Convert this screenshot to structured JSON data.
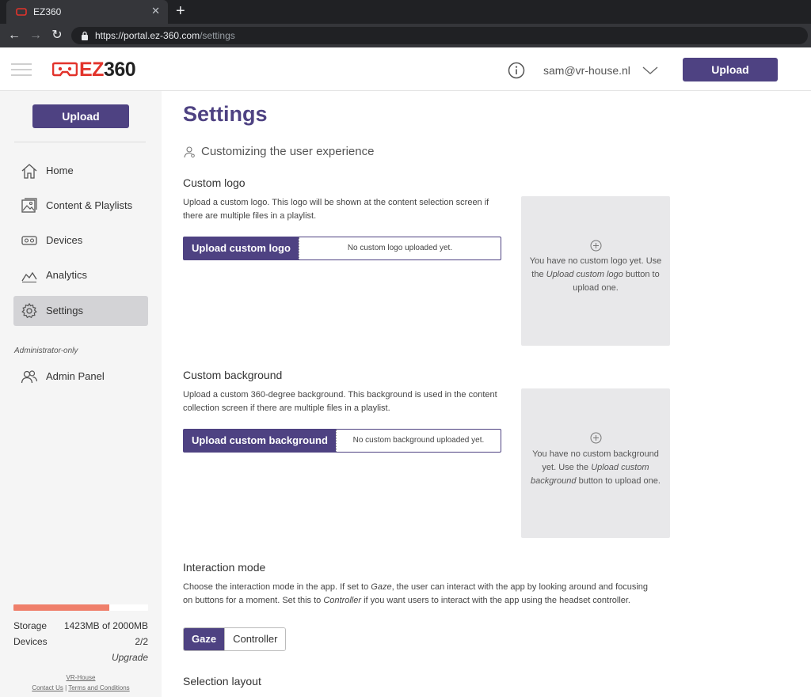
{
  "browser": {
    "tab_title": "EZ360",
    "url_host": "https://portal.ez-360.com",
    "url_path": "/settings"
  },
  "header": {
    "logo_prefix": "EZ",
    "logo_suffix": "360",
    "user_email": "sam@vr-house.nl",
    "upload_label": "Upload"
  },
  "sidebar": {
    "upload_label": "Upload",
    "items": [
      {
        "label": "Home",
        "icon": "home-icon"
      },
      {
        "label": "Content & Playlists",
        "icon": "image-icon"
      },
      {
        "label": "Devices",
        "icon": "vr-headset-icon"
      },
      {
        "label": "Analytics",
        "icon": "line-chart-icon"
      },
      {
        "label": "Settings",
        "icon": "gear-icon",
        "active": true
      }
    ],
    "admin_label": "Administrator-only",
    "admin_item": {
      "label": "Admin Panel",
      "icon": "users-icon"
    },
    "storage_label": "Storage",
    "storage_value": "1423MB of 2000MB",
    "storage_fraction": 0.71,
    "devices_label": "Devices",
    "devices_value": "2/2",
    "upgrade_label": "Upgrade",
    "footer_company": "VR-House",
    "footer_contact": "Contact Us",
    "footer_sep": "|",
    "footer_terms": "Terms and Conditions"
  },
  "main": {
    "title": "Settings",
    "subtitle": "Customizing the user experience",
    "custom_logo": {
      "title": "Custom logo",
      "description": "Upload a custom logo. This logo will be shown at the content selection screen if there are multiple files in a playlist.",
      "button_label": "Upload custom logo",
      "status": "No custom logo uploaded yet.",
      "preview_text_1": "You have no custom logo yet. Use the ",
      "preview_text_em": "Upload custom logo",
      "preview_text_2": " button to upload one."
    },
    "custom_background": {
      "title": "Custom background",
      "description": "Upload a custom 360-degree background. This background is used in the content collection screen if there are multiple files in a playlist.",
      "button_label": "Upload custom background",
      "status": "No custom background uploaded yet.",
      "preview_text_1": "You have no custom background yet. Use the ",
      "preview_text_em": "Upload custom background",
      "preview_text_2": " button to upload one."
    },
    "interaction_mode": {
      "title": "Interaction mode",
      "desc_1": "Choose the interaction mode in the app. If set to ",
      "desc_em1": "Gaze",
      "desc_2": ", the user can interact with the app by looking around and focusing on buttons for a moment. Set this to ",
      "desc_em2": "Controller",
      "desc_3": " if you want users to interact with the app using the headset controller.",
      "options": [
        "Gaze",
        "Controller"
      ],
      "selected": "Gaze"
    },
    "selection_layout": {
      "title": "Selection layout"
    }
  },
  "colors": {
    "brand_purple": "#4e4282",
    "brand_red": "#e2332b",
    "storage_bar": "#ef7f6a"
  }
}
